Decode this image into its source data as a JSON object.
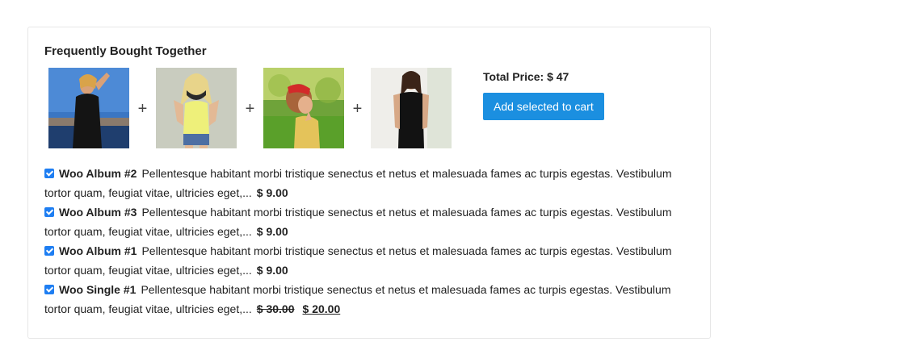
{
  "section": {
    "title": "Frequently Bought Together"
  },
  "images": [
    {
      "alt": "Woo Album #2",
      "icon": "product-photo"
    },
    {
      "alt": "Woo Album #3",
      "icon": "product-photo"
    },
    {
      "alt": "Woo Album #1",
      "icon": "product-photo"
    },
    {
      "alt": "Woo Single #1",
      "icon": "product-photo"
    }
  ],
  "separators": {
    "plus": "+"
  },
  "total": {
    "label": "Total Price: $ 47"
  },
  "actions": {
    "add_to_cart": "Add selected to cart"
  },
  "colors": {
    "button": "#1b8fe0",
    "checkbox": "#1e7ef2"
  },
  "products": [
    {
      "name": "Woo Album #2",
      "description": "Pellentesque habitant morbi tristique senectus et netus et malesuada fames ac turpis egestas. Vestibulum tortor quam, feugiat vitae, ultricies eget,...",
      "price": "$ 9.00",
      "checked": true
    },
    {
      "name": "Woo Album #3",
      "description": "Pellentesque habitant morbi tristique senectus et netus et malesuada fames ac turpis egestas. Vestibulum tortor quam, feugiat vitae, ultricies eget,...",
      "price": "$ 9.00",
      "checked": true
    },
    {
      "name": "Woo Album #1",
      "description": "Pellentesque habitant morbi tristique senectus et netus et malesuada fames ac turpis egestas. Vestibulum tortor quam, feugiat vitae, ultricies eget,...",
      "price": "$ 9.00",
      "checked": true
    },
    {
      "name": "Woo Single #1",
      "description": "Pellentesque habitant morbi tristique senectus et netus et malesuada fames ac turpis egestas. Vestibulum tortor quam, feugiat vitae, ultricies eget,...",
      "regular_price": "$ 30.00",
      "sale_price": "$ 20.00",
      "checked": true
    }
  ]
}
